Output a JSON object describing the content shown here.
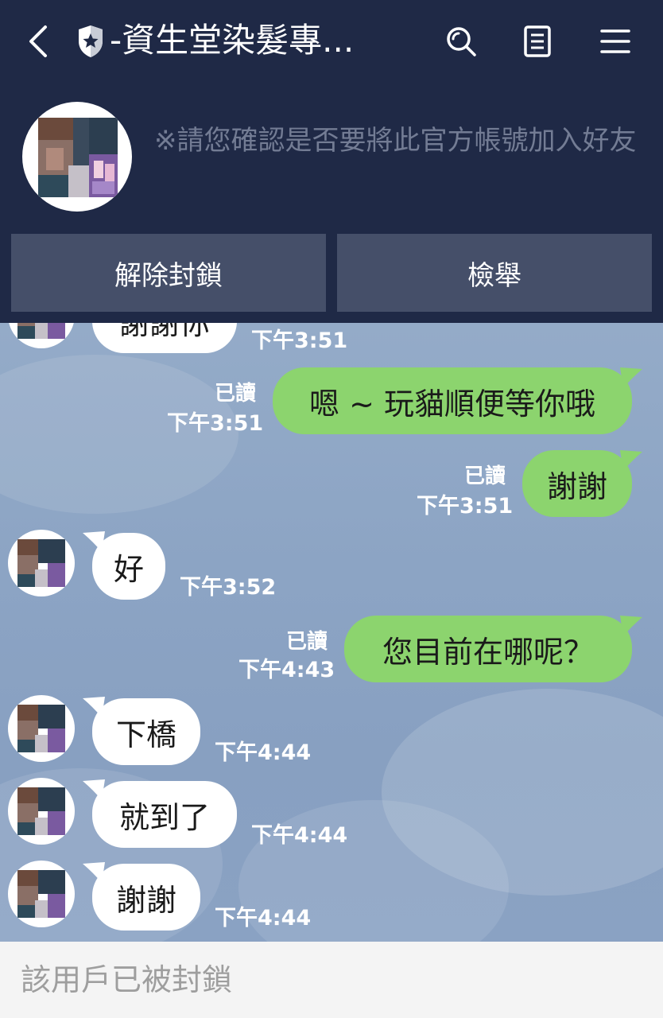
{
  "header": {
    "title": "-資生堂染髮專...",
    "icons": [
      "back-icon",
      "shield-star-icon",
      "search-icon",
      "note-icon",
      "menu-icon"
    ]
  },
  "profile": {
    "notice": "※請您確認是否要將此官方帳號加入好友",
    "unblock_label": "解除封鎖",
    "report_label": "檢舉"
  },
  "messages": [
    {
      "side": "in",
      "text": "謝謝你",
      "time": "下午3:51"
    },
    {
      "side": "out",
      "text": "嗯 ~ 玩貓順便等你哦",
      "read": "已讀",
      "time": "下午3:51"
    },
    {
      "side": "out",
      "text": "謝謝",
      "read": "已讀",
      "time": "下午3:51"
    },
    {
      "side": "in",
      "text": "好",
      "time": "下午3:52"
    },
    {
      "side": "out",
      "text": "您目前在哪呢？",
      "read": "已讀",
      "time": "下午4:43"
    },
    {
      "side": "in",
      "text": "下橋",
      "time": "下午4:44"
    },
    {
      "side": "in",
      "text": "就到了",
      "time": "下午4:44"
    },
    {
      "side": "in",
      "text": "謝謝",
      "time": "下午4:44"
    }
  ],
  "footer": {
    "blocked_text": "該用戶已被封鎖"
  },
  "colors": {
    "header": "#1f2946",
    "button": "#454f69",
    "outgoing_bubble": "#8cd46e",
    "chat_bg": "#8ca4c4"
  }
}
